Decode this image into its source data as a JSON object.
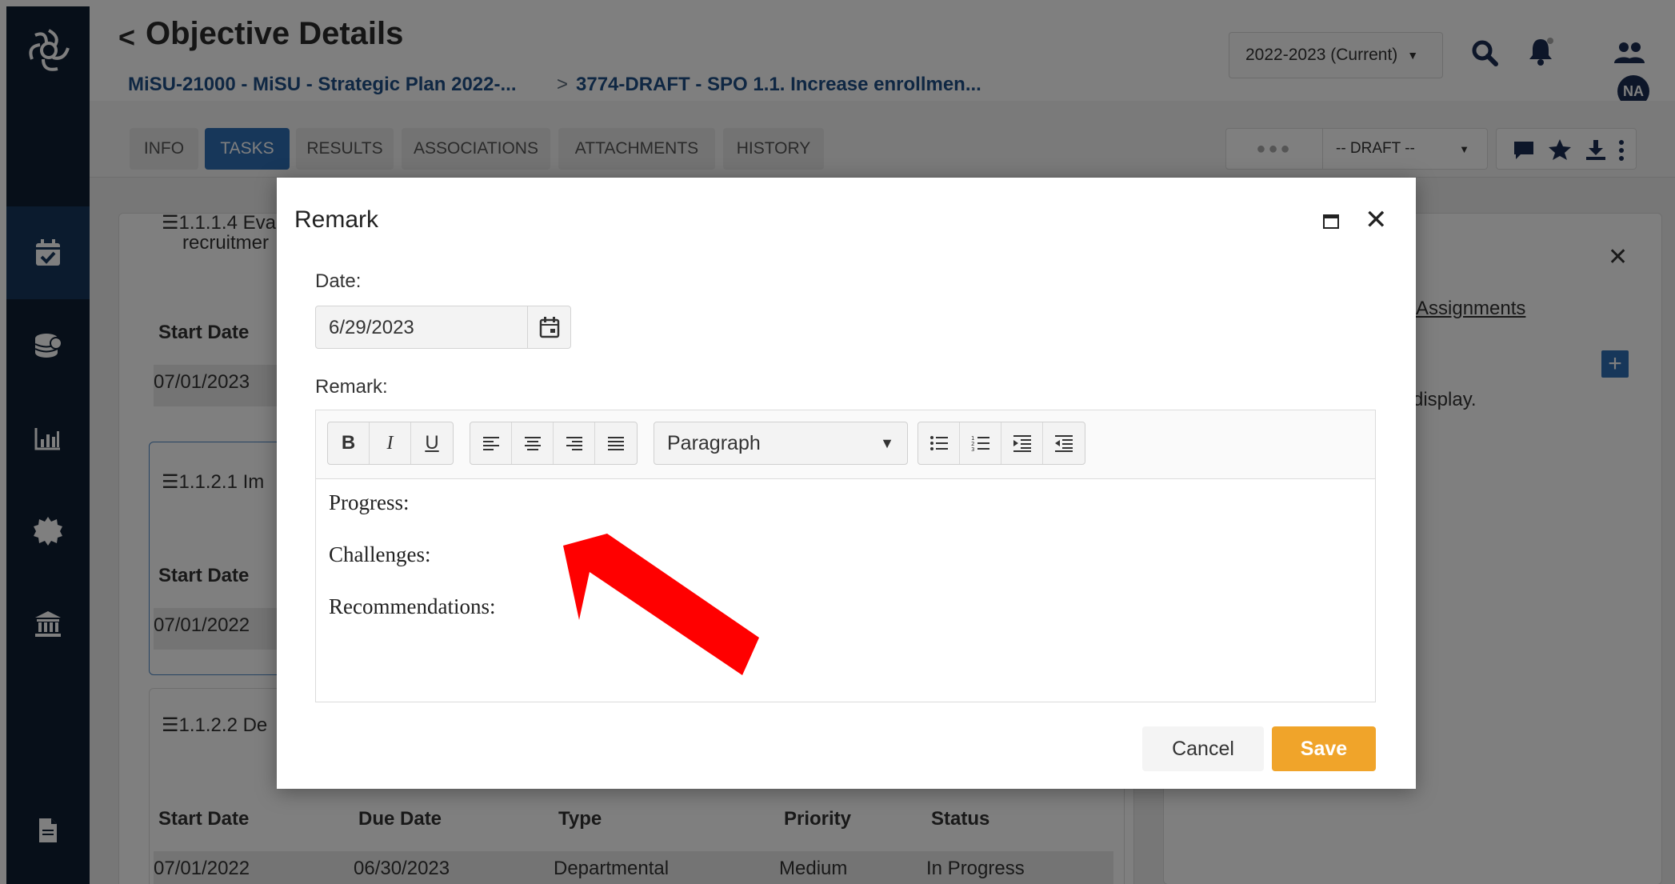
{
  "header": {
    "back_icon": "chevron-left",
    "title": "Objective Details",
    "breadcrumb_1": "MiSU-21000 - MiSU - Strategic Plan 2022-...",
    "breadcrumb_sep": ">",
    "breadcrumb_2": "3774-DRAFT - SPO 1.1. Increase enrollmen...",
    "year_selector": "2022-2023 (Current)",
    "avatar_initials": "NA"
  },
  "tabs": [
    {
      "label": "INFO"
    },
    {
      "label": "TASKS"
    },
    {
      "label": "RESULTS"
    },
    {
      "label": "ASSOCIATIONS"
    },
    {
      "label": "ATTACHMENTS"
    },
    {
      "label": "HISTORY"
    }
  ],
  "status": {
    "dots": "●●●",
    "draft_select": "-- DRAFT --"
  },
  "background": {
    "task_a_title": "☰1.1.1.4 Eva",
    "task_a_sub": "recruitmer",
    "col_start": "Start Date",
    "row_a_start": "07/01/2023",
    "task_b_title": "☰1.1.2.1 Im",
    "row_b_start": "07/01/2022",
    "task_c_title": "☰1.1.2.2 De",
    "col_due": "Due Date",
    "col_type": "Type",
    "col_priority": "Priority",
    "col_status": "Status",
    "row_c_start": "07/01/2022",
    "row_c_due": "06/30/2023",
    "row_c_type": "Departmental",
    "row_c_priority": "Medium",
    "row_c_status": "In Progress",
    "right_link": "Assignments",
    "right_text": "display."
  },
  "dialog": {
    "title": "Remark",
    "date_label": "Date:",
    "date_value": "6/29/2023",
    "remark_label": "Remark:",
    "format_select": "Paragraph",
    "content_lines": [
      "Progress:",
      "Challenges:",
      "Recommendations:"
    ],
    "cancel_label": "Cancel",
    "save_label": "Save"
  },
  "toolbar": {
    "bold": "B",
    "italic": "I",
    "underline": "U"
  },
  "colors": {
    "sidebar": "#0f1e33",
    "accent_blue": "#2f6fb4",
    "save_orange": "#f0a42a",
    "annotation_arrow": "#ff0000"
  }
}
